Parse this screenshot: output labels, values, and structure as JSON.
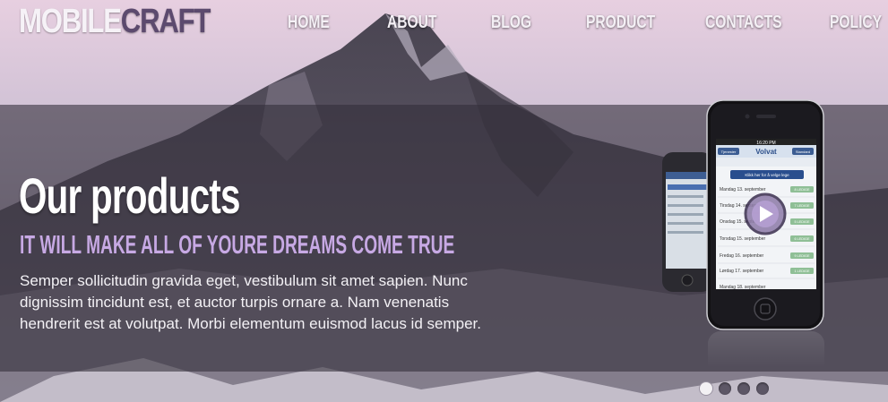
{
  "brand": {
    "part1": "MOBILE",
    "part2": "CRAFT"
  },
  "nav": {
    "items": [
      "HOME",
      "ABOUT",
      "BLOG",
      "PRODUCT",
      "CONTACTS",
      "POLICY"
    ]
  },
  "hero": {
    "title": "Our products",
    "subtitle": "IT WILL MAKE ALL OF YOURE DREAMS COME TRUE",
    "description": "Semper sollicitudin gravida eget, vestibulum sit amet sapien. Nunc dignissim tincidunt est, et auctor turpis ornare a. Nam venenatis hendrerit est at volutpat. Morbi elementum euismod lacus id semper."
  },
  "phone_screen": {
    "time": "16:20 PM",
    "back_label": "Tjenester",
    "app_name": "Volvat",
    "right_label": "Standard",
    "cta": "Klikk her for å velge lege",
    "days": [
      {
        "label": "Mandag 13. september",
        "badge": "8 LEDIGE"
      },
      {
        "label": "Tirsdag 14. september",
        "badge": "7 LEDIGE"
      },
      {
        "label": "Onsdag 15. september",
        "badge": "5 LEDIGE"
      },
      {
        "label": "Torsdag 15. september",
        "badge": "6 LEDIGE"
      },
      {
        "label": "Fredag 16. september",
        "badge": "9 LEDIGE"
      },
      {
        "label": "Lørdag 17. september",
        "badge": "1 LEDIGE"
      },
      {
        "label": "Mandag 18. september",
        "badge": ""
      }
    ]
  },
  "slider": {
    "count": 4,
    "active_index": 0
  },
  "colors": {
    "accent": "#c7a9e4",
    "brand_dark": "#5c4a6e",
    "band": "#342e3a",
    "badge": "#8fbf96"
  },
  "icons": {
    "play": "play-icon"
  }
}
